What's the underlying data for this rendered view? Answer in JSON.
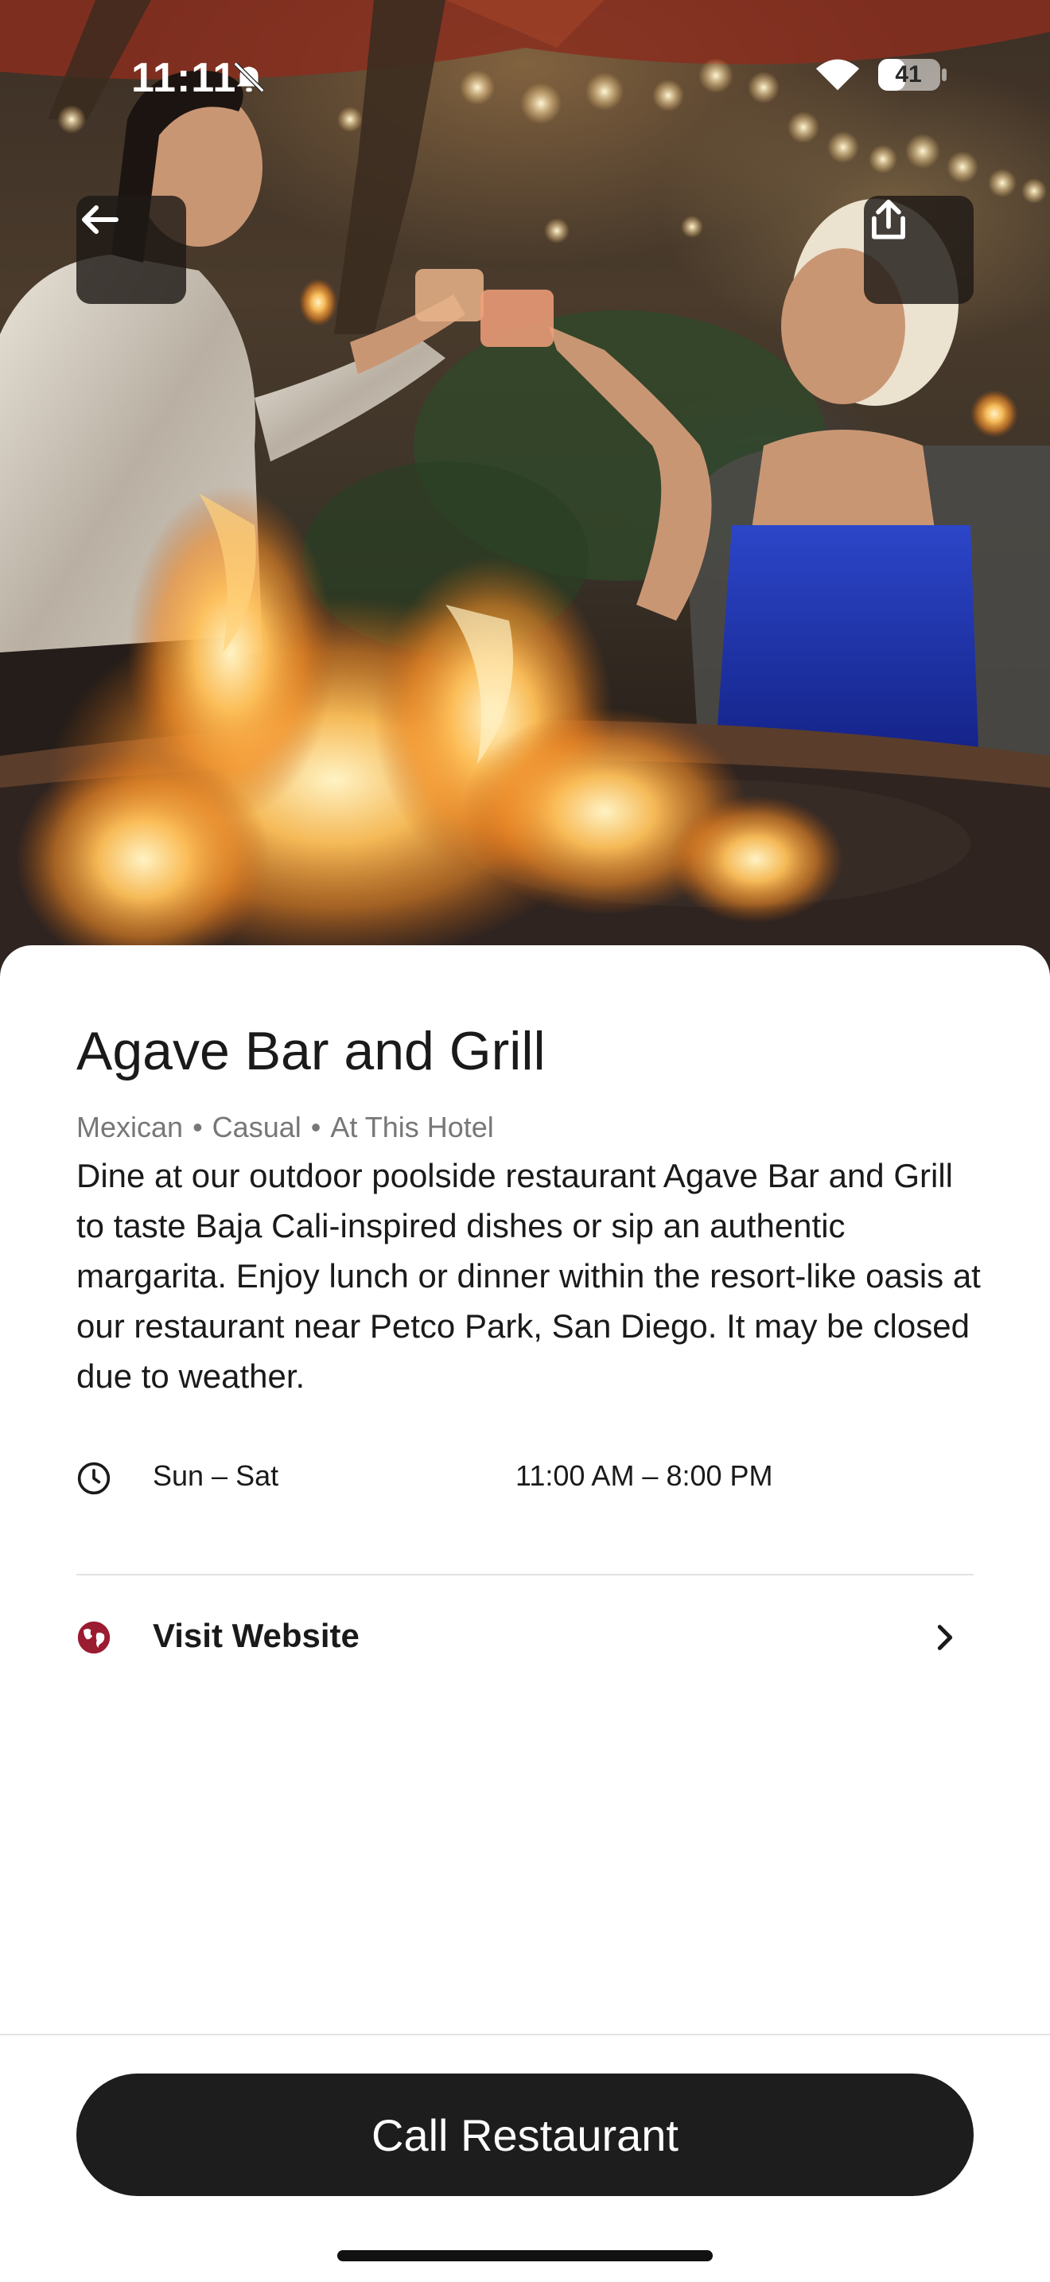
{
  "status_bar": {
    "time": "11:11",
    "battery": "41"
  },
  "hero": {
    "back_icon": "arrow-left-icon",
    "share_icon": "share-icon"
  },
  "restaurant": {
    "name": "Agave Bar and Grill",
    "tags": [
      "Mexican",
      "Casual",
      "At This Hotel"
    ],
    "description": "Dine at our outdoor poolside restaurant Agave Bar and Grill to taste Baja Cali-inspired dishes or sip an authentic margarita. Enjoy lunch or dinner within the resort-like oasis at our restaurant near Petco Park, San Diego. It may be closed due to weather."
  },
  "hours": {
    "icon": "clock-icon",
    "days": "Sun – Sat",
    "time": "11:00 AM – 8:00 PM"
  },
  "website": {
    "icon": "globe-icon",
    "label": "Visit Website",
    "chevron_icon": "chevron-right-icon"
  },
  "cta": {
    "label": "Call Restaurant"
  },
  "colors": {
    "accent": "#9b1b30",
    "button": "#1d1d1d",
    "muted_text": "#777777"
  }
}
